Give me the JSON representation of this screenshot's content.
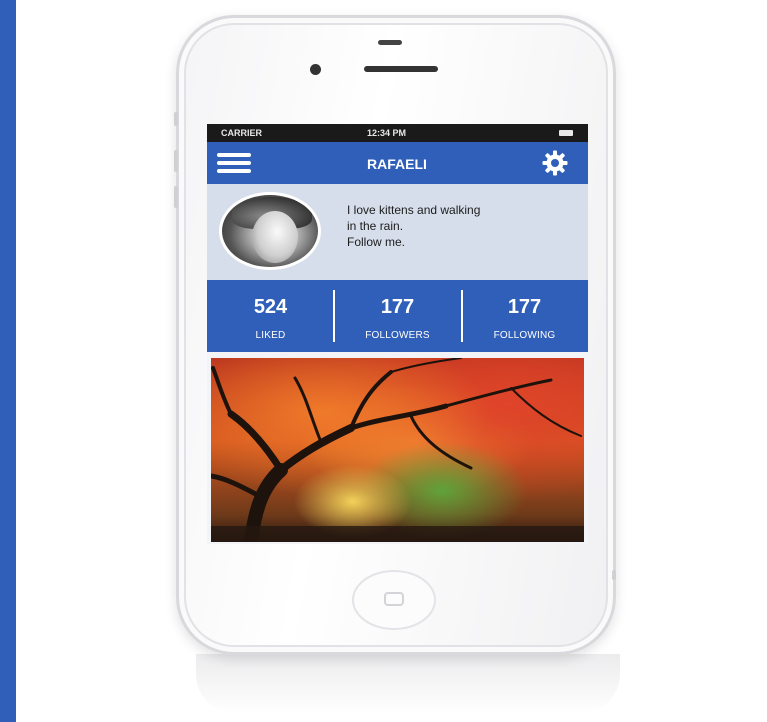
{
  "status_bar": {
    "carrier": "CARRIER",
    "time": "12:34 PM"
  },
  "nav": {
    "title": "RAFAELI",
    "menu_icon": "hamburger-menu-icon",
    "settings_icon": "gear-icon"
  },
  "profile": {
    "bio_lines": [
      "I love kittens and walking",
      "in the rain.",
      "Follow me."
    ]
  },
  "stats": [
    {
      "value": "524",
      "label": "LIKED"
    },
    {
      "value": "177",
      "label": "FOLLOWERS"
    },
    {
      "value": "177",
      "label": "FOLLOWING"
    }
  ],
  "colors": {
    "accent_blue": "#2f5fb8",
    "profile_background": "#d7deeb",
    "status_bar": "#1a1a1a"
  }
}
